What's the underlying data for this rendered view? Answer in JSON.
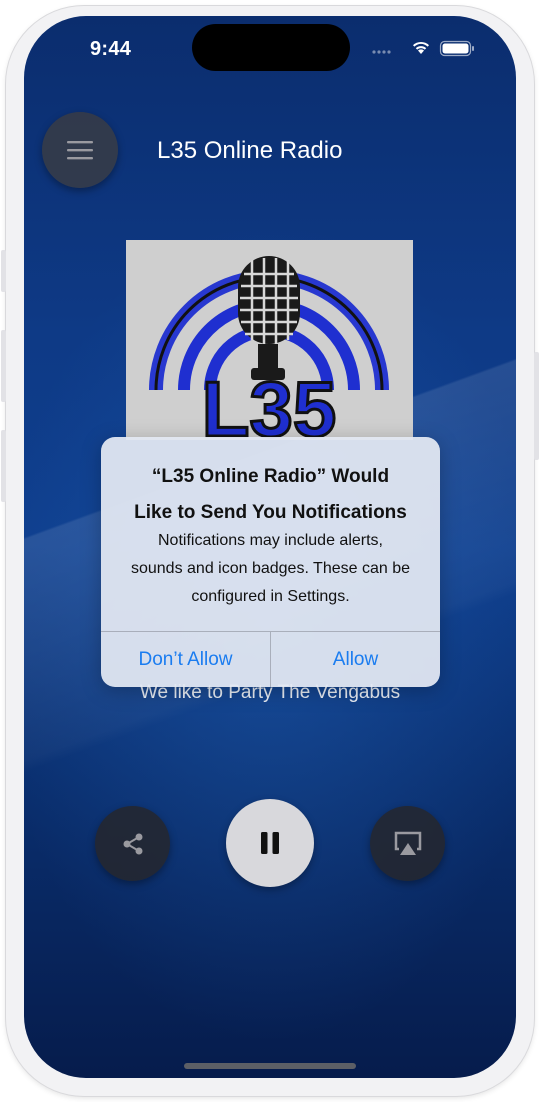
{
  "status_bar": {
    "time": "9:44"
  },
  "header": {
    "title": "L35 Online Radio",
    "menu_icon": "hamburger-menu-icon"
  },
  "album_art": {
    "logo_text": "L35",
    "icon": "microphone-logo-icon"
  },
  "now_playing": {
    "track": "We like to Party The Vengabus"
  },
  "controls": {
    "share_icon": "share-icon",
    "pause_icon": "pause-icon",
    "airplay_icon": "airplay-icon"
  },
  "alert": {
    "title_line1": "“L35 Online Radio” Would",
    "title_line2": "Like to Send You Notifications",
    "message_line1": "Notifications may include alerts,",
    "message_line2": "sounds and icon badges. These can be",
    "message_line3": "configured in Settings.",
    "dont_allow_label": "Don’t Allow",
    "allow_label": "Allow"
  },
  "colors": {
    "accent": "#1a7cf0",
    "background": "#0e3a86",
    "logo_blue": "#1f2fd0"
  }
}
